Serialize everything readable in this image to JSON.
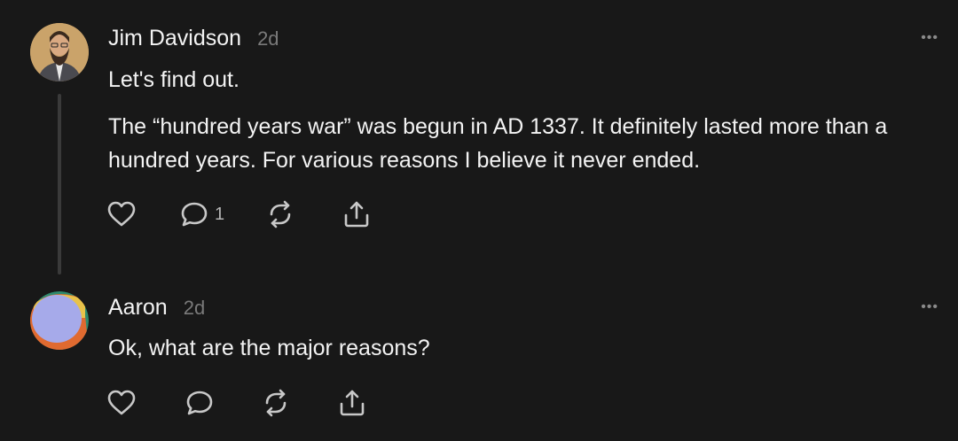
{
  "posts": [
    {
      "author": "Jim Davidson",
      "time": "2d",
      "more_label": "•••",
      "paragraph1": "Let's find out.",
      "paragraph2": "The “hundred years war” was begun in AD 1337. It definitely lasted more than a hundred years. For various reasons I believe it never ended.",
      "reply_count": "1",
      "icons": [
        "heart-icon",
        "comment-icon",
        "repost-icon",
        "share-icon"
      ]
    },
    {
      "author": "Aaron",
      "time": "2d",
      "more_label": "•••",
      "paragraph1": "Ok, what are the major reasons?",
      "icons": [
        "heart-icon",
        "comment-icon",
        "repost-icon",
        "share-icon"
      ]
    }
  ],
  "colors": {
    "background": "#181818",
    "text": "#f3f3f3",
    "muted": "#7a7a7a",
    "thread_line": "#3a3a3a"
  }
}
